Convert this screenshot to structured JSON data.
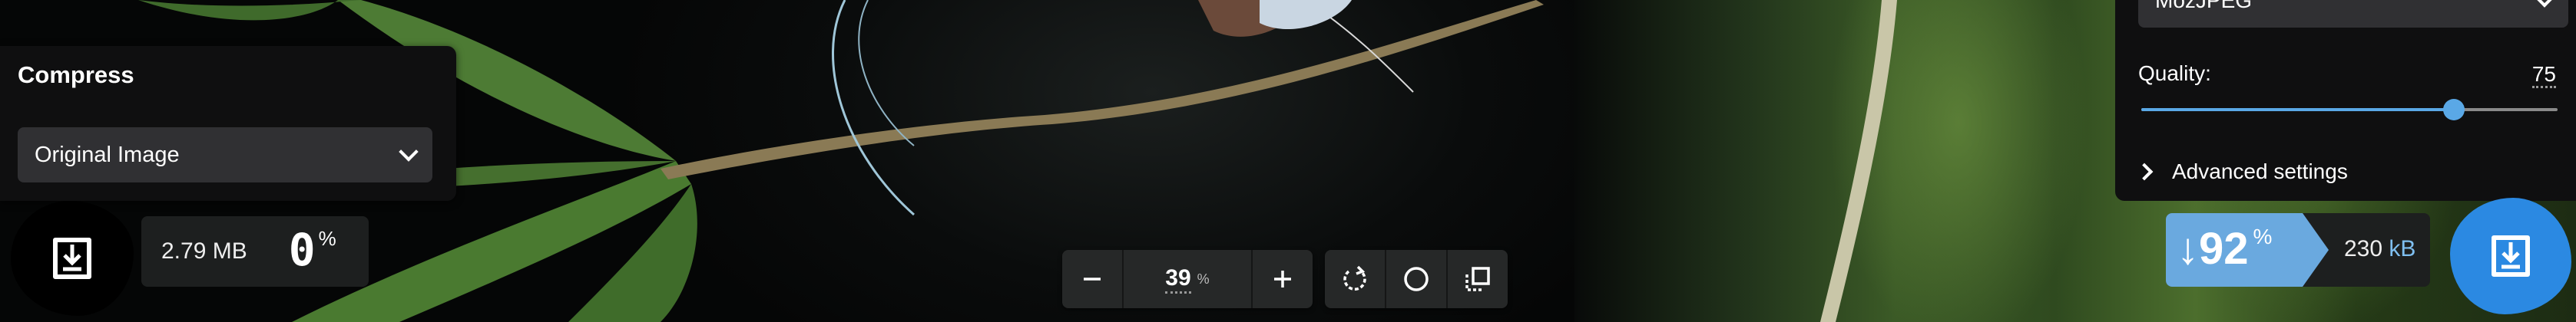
{
  "left_panel": {
    "title": "Compress",
    "method_select": {
      "value": "Original Image"
    }
  },
  "left_stats": {
    "size": "2.79 MB",
    "percent": "0",
    "percent_symbol": "%",
    "download_icon": "download-icon"
  },
  "zoom": {
    "value": "39",
    "unit": "%",
    "minus_icon": "minus-icon",
    "plus_icon": "plus-icon",
    "rotate_icon": "rotate-icon",
    "background_icon": "circle-icon",
    "crop_icon": "crop-icon"
  },
  "right_panel": {
    "codec_select": {
      "value": "MozJPEG"
    },
    "quality": {
      "label": "Quality:",
      "value": "75",
      "level_fraction": 0.75
    },
    "advanced": {
      "label": "Advanced settings"
    }
  },
  "right_stats": {
    "reduction_arrow": "↓",
    "reduction": "92",
    "reduction_symbol": "%",
    "size_value": "230",
    "size_unit": "kB",
    "download_icon": "download-icon"
  },
  "colors": {
    "accent_blue": "#2b89e2",
    "reduction_blue": "#6aa9df",
    "panel_bg": "#0f0f10",
    "control_bg": "#303033"
  }
}
